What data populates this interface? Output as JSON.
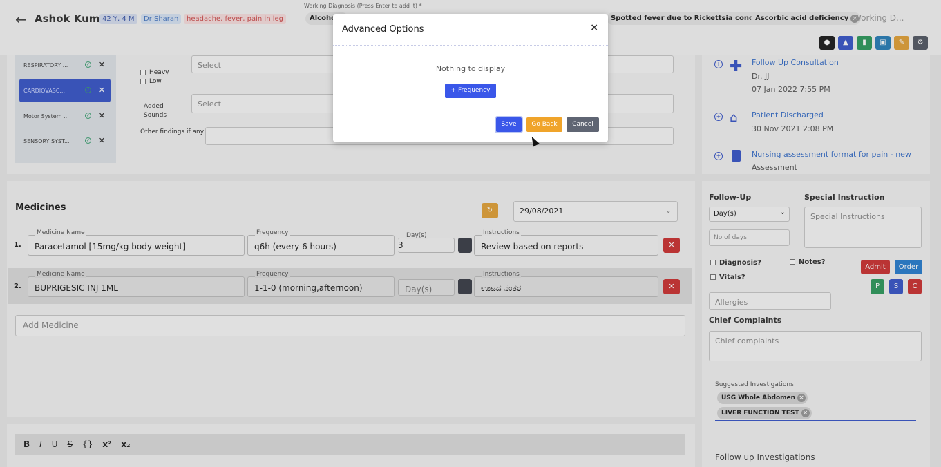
{
  "header": {
    "patient_name": "Ashok Kumar",
    "age_sex": "42 Y, 4 M",
    "doctor": "Dr Sharan",
    "complaints": "headache, fever, pain in leg",
    "working_diagnosis_label": "Working Diagnosis (Press Enter to add it) *",
    "diagnoses": [
      "Alcoho",
      "Spotted fever due to Rickettsia conorii",
      "Ascorbic acid deficiency"
    ],
    "diagnosis_placeholder": "Working D...",
    "action_buttons": [
      {
        "icon": "user-icon",
        "color": "#1e1e1e"
      },
      {
        "icon": "lock-icon",
        "color": "#3a57c9"
      },
      {
        "icon": "book-icon",
        "color": "#2f9a5e"
      },
      {
        "icon": "image-icon",
        "color": "#2a7fb8"
      },
      {
        "icon": "pencil-icon",
        "color": "#e2a23a"
      },
      {
        "icon": "settings-icon",
        "color": "#555b66"
      }
    ]
  },
  "systems": {
    "items": [
      {
        "label": "RESPIRATORY ..."
      },
      {
        "label": "CARDIOVASC..."
      },
      {
        "label": "Motor System ..."
      },
      {
        "label": "SENSORY SYST..."
      }
    ],
    "active_index": 1
  },
  "exam": {
    "heavy": "Heavy",
    "low": "Low",
    "select1": "Select",
    "added_sounds": "Added Sounds",
    "select2": "Select",
    "other_findings": "Other findings if any"
  },
  "medicines": {
    "title": "Medicines",
    "date": "29/08/2021",
    "rows": [
      {
        "num": "1.",
        "name_label": "Medicine Name",
        "name": "Paracetamol [15mg/kg body weight]",
        "freq_label": "Frequency",
        "freq": "q6h (every 6 hours)",
        "days_label": "Day(s)",
        "days": "3",
        "instr_label": "Instructions",
        "instr": "Review based on reports"
      },
      {
        "num": "2.",
        "name_label": "Medicine Name",
        "name": "BUPRIGESIC INJ 1ML",
        "freq_label": "Frequency",
        "freq": "1-1-0 (morning,afternoon)",
        "days_label": "",
        "days": "Day(s)",
        "instr_label": "Instructions",
        "instr": "ಊಟದ ನಂತರ"
      }
    ],
    "add_placeholder": "Add Medicine"
  },
  "editor": {
    "tools": [
      "B",
      "I",
      "U",
      "S",
      "{}",
      "x²",
      "x₂"
    ]
  },
  "timeline": [
    {
      "title": "Follow Up Consultation",
      "line2": "Dr. JJ",
      "line3": "07 Jan 2022 7:55 PM",
      "icon": "plus-icon"
    },
    {
      "title": "Patient Discharged",
      "line2": "30 Nov 2021 2:08 PM",
      "icon": "home-icon"
    },
    {
      "title": "Nursing assessment format for pain - new",
      "line2": "Assessment",
      "icon": "document-icon"
    }
  ],
  "right": {
    "followup_label": "Follow-Up",
    "followup_unit": "Day(s)",
    "no_of_days": "No of days",
    "special_label": "Special Instruction",
    "special_placeholder": "Special Instructions",
    "diagnosis_cb": "Diagnosis?",
    "notes_cb": "Notes?",
    "vitals_cb": "Vitals?",
    "admit": "Admit",
    "order": "Order",
    "p": "P",
    "s": "S",
    "c": "C",
    "allergies": "Allergies",
    "chief_label": "Chief Complaints",
    "chief_placeholder": "Chief complaints",
    "suggested_label": "Suggested Investigations",
    "suggested": [
      "USG Whole Abdomen",
      "LIVER FUNCTION TEST"
    ],
    "followup_inv": "Follow up Investigations"
  },
  "modal": {
    "title": "Advanced Options",
    "close": "×",
    "empty": "Nothing to display",
    "frequency_button": "+ Frequency",
    "save": "Save",
    "go_back": "Go Back",
    "cancel": "Cancel"
  }
}
